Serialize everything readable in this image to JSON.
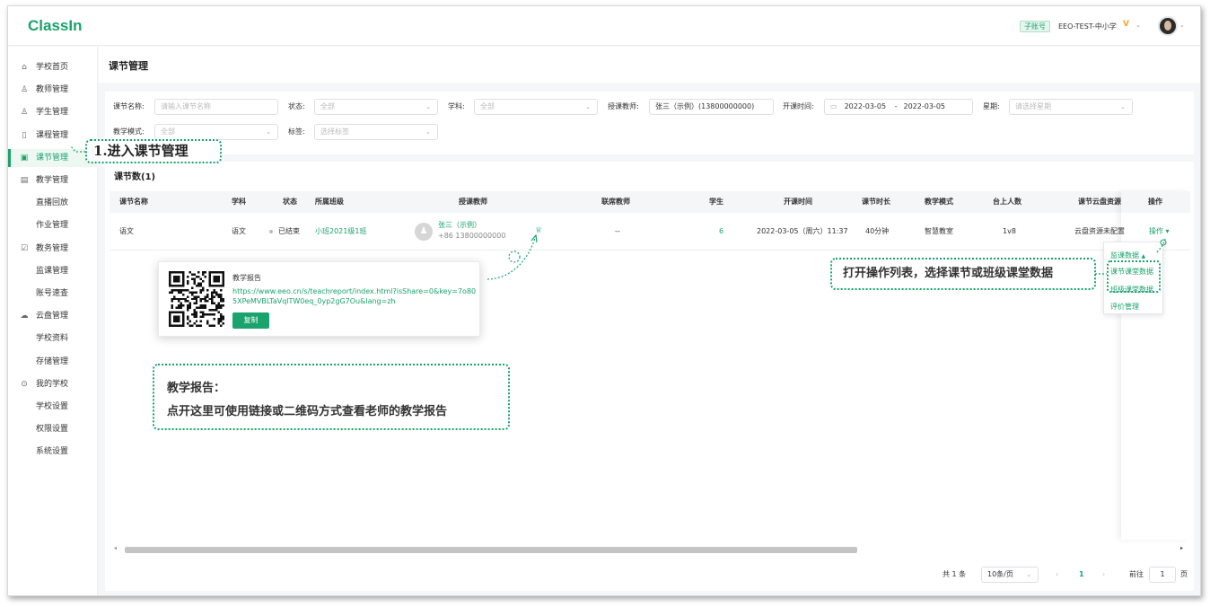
{
  "topbar": {
    "logo": "ClassIn",
    "sub_account_badge": "子账号",
    "account_name": "EEO-TEST-中小学",
    "vip_badge": "V",
    "chevron": "⌄"
  },
  "sidebar": {
    "items": [
      {
        "label": "学校首页",
        "icon": "home-icon",
        "glyph": "⌂"
      },
      {
        "label": "教师管理",
        "icon": "user-icon",
        "glyph": "♙"
      },
      {
        "label": "学生管理",
        "icon": "users-icon",
        "glyph": "♙"
      },
      {
        "label": "课程管理",
        "icon": "columns-icon",
        "glyph": "▯"
      },
      {
        "label": "课节管理",
        "icon": "calendar-icon",
        "glyph": "▣",
        "active": true
      },
      {
        "label": "教学管理",
        "icon": "chart-icon",
        "glyph": "▤"
      },
      {
        "label": "直播回放",
        "icon": "",
        "glyph": ""
      },
      {
        "label": "作业管理",
        "icon": "",
        "glyph": ""
      },
      {
        "label": "教务管理",
        "icon": "checkbox-icon",
        "glyph": "☑"
      },
      {
        "label": "监课管理",
        "icon": "",
        "glyph": ""
      },
      {
        "label": "账号速查",
        "icon": "",
        "glyph": ""
      },
      {
        "label": "云盘管理",
        "icon": "cloud-icon",
        "glyph": "☁"
      },
      {
        "label": "学校资料",
        "icon": "",
        "glyph": ""
      },
      {
        "label": "存储管理",
        "icon": "",
        "glyph": ""
      },
      {
        "label": "我的学校",
        "icon": "school-icon",
        "glyph": "⊙"
      },
      {
        "label": "学校设置",
        "icon": "",
        "glyph": ""
      },
      {
        "label": "权限设置",
        "icon": "",
        "glyph": ""
      },
      {
        "label": "系统设置",
        "icon": "",
        "glyph": ""
      }
    ]
  },
  "page": {
    "title": "课节管理"
  },
  "filters": {
    "lesson_name_label": "课节名称:",
    "lesson_name_placeholder": "请输入课节名称",
    "status_label": "状态:",
    "status_value": "全部",
    "subject_label": "学科:",
    "subject_value": "全部",
    "teacher_label": "授课教师:",
    "teacher_value": "张三（示例）(13800000000)",
    "time_label": "开课时间:",
    "date_from": "2022-03-05",
    "date_sep": "-",
    "date_to": "2022-03-05",
    "week_label": "星期:",
    "week_placeholder": "请选择星期",
    "mode_label": "教学模式:",
    "mode_value": "全部",
    "tag_label": "标签:",
    "tag_placeholder": "选择标签"
  },
  "table": {
    "title": "课节数(1)",
    "headers": [
      "课节名称",
      "学科",
      "状态",
      "所属班级",
      "授课教师",
      "联席教师",
      "学生",
      "开课时间",
      "课节时长",
      "教学模式",
      "台上人数",
      "课节云盘资源",
      "操作"
    ],
    "row": {
      "name": "语文",
      "subject": "语文",
      "status": "已结束",
      "class": "小班2021级1班",
      "teacher_name": "张三（示例）",
      "teacher_phone": "+86 13800000000",
      "co_teacher": "--",
      "students": "6",
      "start_time": "2022-03-05（周六）11:37",
      "duration": "40分钟",
      "mode": "智慧教室",
      "stage_count": "1v8",
      "cloud": "云盘资源未配置",
      "op": "操作 ▾"
    }
  },
  "op_menu": {
    "items": [
      "监课数据",
      "课节课堂数据",
      "班级课堂数据",
      "评价管理"
    ]
  },
  "report_popup": {
    "title": "教学报告",
    "link": "https://www.eeo.cn/s/teachreport/index.html?isShare=0&key=7o805XPeMVBLTaVqlTW0eq_0yp2gG7Ou&lang=zh",
    "copy_label": "复制"
  },
  "pager": {
    "total": "共 1 条",
    "page_size": "10条/页",
    "prev": "‹",
    "page": "1",
    "next": "›",
    "goto_label": "前往",
    "goto_value": "1",
    "page_unit": "页"
  },
  "callouts": {
    "step1": "1.进入课节管理",
    "ops": "打开操作列表，选择课节或班级课堂数据",
    "report_line1": "教学报告：",
    "report_line2": "点开这里可使用链接或二维码方式查看老师的教学报告"
  },
  "colors": {
    "brand": "#1aa36d",
    "background": "#f5f6f7"
  }
}
